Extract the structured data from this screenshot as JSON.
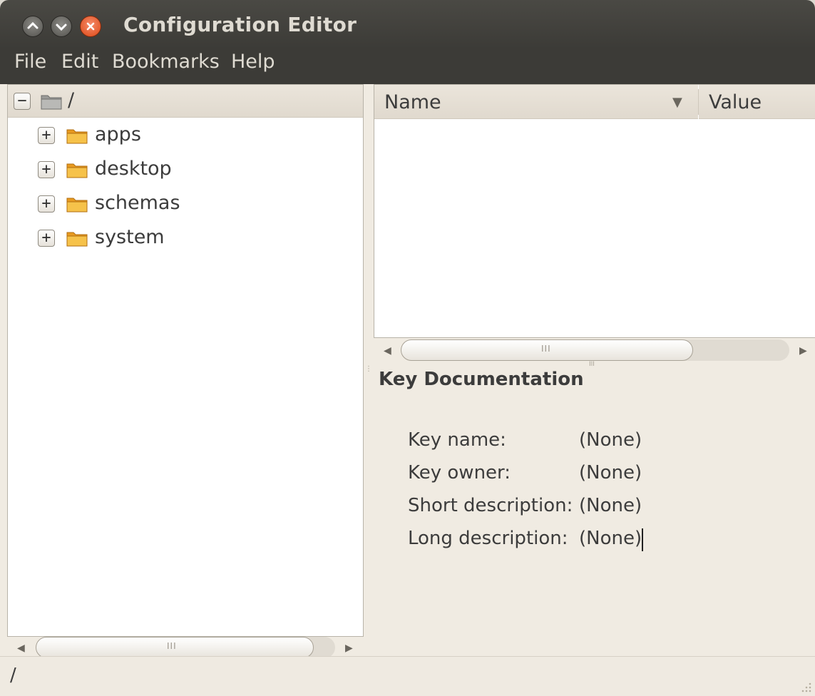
{
  "window": {
    "title": "Configuration Editor"
  },
  "menubar": {
    "items": [
      "File",
      "Edit",
      "Bookmarks",
      "Help"
    ]
  },
  "tree": {
    "root": {
      "expander": "−",
      "label": "/"
    },
    "items": [
      {
        "expander": "+",
        "label": "apps"
      },
      {
        "expander": "+",
        "label": "desktop"
      },
      {
        "expander": "+",
        "label": "schemas"
      },
      {
        "expander": "+",
        "label": "system"
      }
    ]
  },
  "table": {
    "columns": {
      "name": "Name",
      "value": "Value"
    },
    "sort_indicator": "▼",
    "rows": []
  },
  "documentation": {
    "title": "Key Documentation",
    "fields": [
      {
        "label": "Key name:",
        "value": "(None)"
      },
      {
        "label": "Key owner:",
        "value": "(None)"
      },
      {
        "label": "Short description:",
        "value": "(None)"
      },
      {
        "label": "Long description:",
        "value": "(None)"
      }
    ]
  },
  "status": {
    "path": "/"
  },
  "icons": {
    "minimize": "minimize-icon",
    "maximize": "maximize-icon",
    "close": "close-icon",
    "folder": "folder-icon",
    "sort": "sort-descending-icon",
    "scroll_left": "scroll-left-arrow-icon",
    "scroll_right": "scroll-right-arrow-icon"
  },
  "colors": {
    "titlebar": "#3c3b37",
    "close_button": "#dd4814",
    "window_bg": "#f0ebe2",
    "folder": "#f0a830"
  }
}
